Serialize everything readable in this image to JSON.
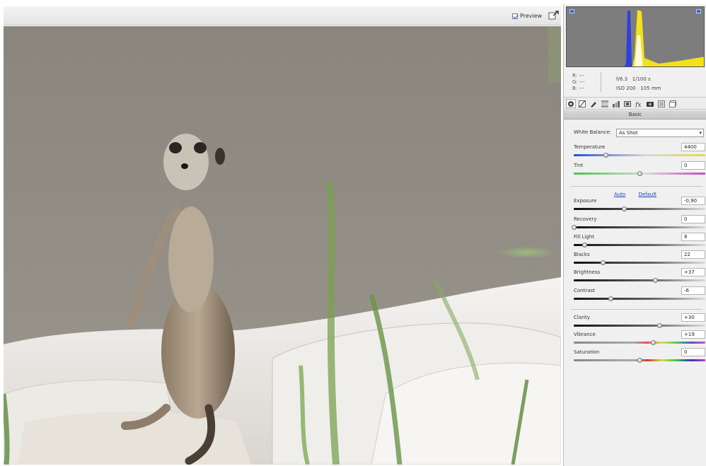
{
  "preview": {
    "checkbox_label": "Preview",
    "checked": true
  },
  "icons": {
    "fullscreen": "fullscreen-toggle-icon",
    "clip_shadow": "shadow-clipping-warning-icon",
    "clip_highlight": "highlight-clipping-warning-icon"
  },
  "readout": {
    "rgb_labels": [
      "R:",
      "G:",
      "B:"
    ],
    "rgb_values": [
      "---",
      "---",
      "---"
    ],
    "exif_line1": "f/6.3   1/100 s",
    "exif_line2": "ISO 200   105 mm"
  },
  "tabs": [
    {
      "icon": "basic-tab-icon",
      "active": true
    },
    {
      "icon": "tone-curve-tab-icon",
      "active": false
    },
    {
      "icon": "detail-tab-icon",
      "active": false
    },
    {
      "icon": "hsl-tab-icon",
      "active": false
    },
    {
      "icon": "split-toning-tab-icon",
      "active": false
    },
    {
      "icon": "lens-corrections-tab-icon",
      "active": false
    },
    {
      "icon": "effects-tab-icon",
      "active": false
    },
    {
      "icon": "camera-calibration-tab-icon",
      "active": false
    },
    {
      "icon": "presets-tab-icon",
      "active": false
    },
    {
      "icon": "snapshots-tab-icon",
      "active": false
    }
  ],
  "section_title": "Basic",
  "white_balance": {
    "label": "White Balance:",
    "value": "As Shot"
  },
  "links": {
    "auto": "Auto",
    "default": "Default"
  },
  "sliders": [
    {
      "id": "temperature",
      "label": "Temperature",
      "value": "4400",
      "position": 0.24,
      "track": "temp"
    },
    {
      "id": "tint",
      "label": "Tint",
      "value": "0",
      "position": 0.5,
      "track": "tint"
    },
    {
      "id": "exposure",
      "label": "Exposure",
      "value": "-0,90",
      "position": 0.38,
      "track": "dark"
    },
    {
      "id": "recovery",
      "label": "Recovery",
      "value": "0",
      "position": 0.0,
      "track": "dark"
    },
    {
      "id": "fill-light",
      "label": "Fill Light",
      "value": "8",
      "position": 0.08,
      "track": "dark"
    },
    {
      "id": "blacks",
      "label": "Blacks",
      "value": "22",
      "position": 0.22,
      "track": "dark"
    },
    {
      "id": "brightness",
      "label": "Brightness",
      "value": "+37",
      "position": 0.62,
      "track": "dark"
    },
    {
      "id": "contrast",
      "label": "Contrast",
      "value": "-6",
      "position": 0.28,
      "track": "dark"
    },
    {
      "id": "clarity",
      "label": "Clarity",
      "value": "+30",
      "position": 0.65,
      "track": "dark"
    },
    {
      "id": "vibrance",
      "label": "Vibrance",
      "value": "+19",
      "position": 0.6,
      "track": "vib"
    },
    {
      "id": "saturation",
      "label": "Saturation",
      "value": "0",
      "position": 0.5,
      "track": "sat"
    }
  ],
  "colors": {
    "panel_bg": "#f0f0f0",
    "link": "#1e3fbf",
    "histogram_bg": "#7d7d7d",
    "histogram_blue": "#2f3fe0",
    "histogram_yellow": "#f2e11c"
  }
}
